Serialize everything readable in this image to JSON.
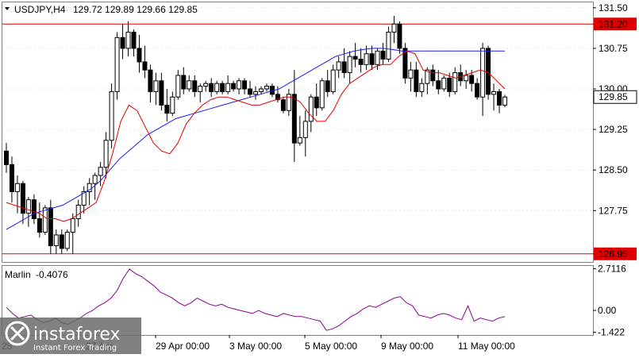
{
  "header": {
    "symbol": "USDJPY,H4",
    "ohlc": "129.72 129.89 129.66 129.85"
  },
  "indicator": {
    "name": "Marlin",
    "value": "-0.4076",
    "ticks": [
      "2.7116",
      "0.00",
      "-1.422"
    ]
  },
  "price_axis": {
    "ticks": [
      "131.50",
      "131.20",
      "130.75",
      "130.00",
      "129.85",
      "129.25",
      "128.50",
      "127.75",
      "126.95"
    ],
    "highlighted": [
      "131.20",
      "126.95"
    ],
    "current": "129.85"
  },
  "time_axis": {
    "labels": [
      "29 Apr 00:00",
      "3 May 00:00",
      "5 May 00:00",
      "9 May 00:00",
      "11 May 00:00"
    ],
    "partial_labels": [
      "25",
      "27 Apr"
    ]
  },
  "logo": {
    "brand": "instaforex",
    "tagline": "Instant Forex Trading"
  },
  "colors": {
    "resistance_line": "#e00000",
    "ma_fast": "#e00000",
    "ma_slow": "#1a1aff",
    "oscillator": "#8b008b",
    "bull_candle": "#ffffff",
    "bear_candle": "#000000"
  },
  "chart_data": [
    {
      "type": "candlestick",
      "title": "USDJPY,H4",
      "ylim": [
        126.8,
        131.6
      ],
      "horizontal_lines": [
        131.2,
        126.95
      ],
      "current_price": 129.85,
      "candles": [
        [
          128.85,
          129.0,
          128.45,
          128.6
        ],
        [
          128.6,
          128.75,
          127.9,
          128.1
        ],
        [
          128.1,
          128.4,
          127.7,
          128.25
        ],
        [
          128.25,
          128.3,
          127.5,
          127.7
        ],
        [
          127.7,
          128.0,
          127.45,
          127.95
        ],
        [
          127.95,
          128.05,
          127.5,
          127.6
        ],
        [
          127.6,
          127.9,
          127.25,
          127.35
        ],
        [
          127.35,
          127.85,
          127.3,
          127.8
        ],
        [
          127.8,
          127.95,
          126.95,
          127.1
        ],
        [
          127.1,
          127.4,
          126.95,
          127.3
        ],
        [
          127.3,
          127.4,
          126.95,
          127.05
        ],
        [
          127.05,
          127.4,
          127.0,
          127.35
        ],
        [
          127.35,
          127.7,
          126.95,
          127.6
        ],
        [
          127.6,
          127.95,
          127.45,
          127.85
        ],
        [
          127.85,
          128.2,
          127.7,
          128.1
        ],
        [
          128.1,
          128.35,
          127.85,
          128.25
        ],
        [
          128.25,
          128.45,
          127.95,
          128.4
        ],
        [
          128.4,
          128.65,
          128.2,
          128.55
        ],
        [
          128.55,
          129.2,
          128.35,
          129.05
        ],
        [
          129.05,
          130.1,
          128.9,
          129.95
        ],
        [
          129.95,
          131.05,
          129.8,
          130.95
        ],
        [
          130.95,
          131.2,
          130.55,
          130.75
        ],
        [
          130.75,
          131.25,
          130.6,
          131.05
        ],
        [
          131.05,
          131.1,
          130.6,
          130.75
        ],
        [
          130.75,
          131.0,
          130.3,
          130.5
        ],
        [
          130.5,
          130.8,
          130.2,
          130.35
        ],
        [
          130.35,
          130.45,
          129.75,
          129.95
        ],
        [
          129.95,
          130.3,
          129.7,
          130.15
        ],
        [
          130.15,
          130.3,
          129.6,
          129.7
        ],
        [
          129.7,
          130.0,
          129.4,
          129.55
        ],
        [
          129.55,
          129.95,
          129.5,
          129.85
        ],
        [
          129.85,
          130.35,
          129.8,
          130.25
        ],
        [
          130.25,
          130.4,
          129.9,
          130.0
        ],
        [
          130.0,
          130.25,
          129.95,
          130.15
        ],
        [
          130.15,
          130.25,
          129.85,
          129.95
        ],
        [
          129.95,
          130.1,
          129.75,
          130.05
        ],
        [
          130.05,
          130.15,
          129.95,
          130.1
        ],
        [
          130.1,
          130.2,
          129.85,
          129.95
        ],
        [
          129.95,
          130.15,
          129.9,
          130.1
        ],
        [
          130.1,
          130.15,
          129.9,
          129.95
        ],
        [
          129.95,
          130.25,
          129.9,
          130.1
        ],
        [
          130.1,
          130.15,
          129.95,
          130.0
        ],
        [
          130.0,
          130.2,
          129.9,
          130.15
        ],
        [
          130.15,
          130.2,
          129.9,
          130.0
        ],
        [
          130.0,
          130.15,
          129.85,
          129.9
        ],
        [
          129.9,
          130.05,
          129.8,
          129.95
        ],
        [
          129.95,
          130.05,
          129.9,
          130.0
        ],
        [
          130.0,
          130.1,
          129.95,
          130.05
        ],
        [
          130.05,
          130.1,
          129.85,
          129.9
        ],
        [
          129.9,
          130.05,
          129.75,
          129.8
        ],
        [
          129.8,
          129.85,
          129.55,
          129.6
        ],
        [
          129.6,
          130.0,
          129.5,
          129.9
        ],
        [
          129.9,
          130.35,
          128.65,
          129.0
        ],
        [
          129.0,
          129.5,
          128.95,
          129.1
        ],
        [
          129.1,
          129.6,
          128.75,
          129.4
        ],
        [
          129.4,
          129.9,
          129.2,
          129.85
        ],
        [
          129.85,
          130.1,
          129.5,
          129.65
        ],
        [
          129.65,
          130.2,
          129.6,
          130.15
        ],
        [
          130.15,
          130.35,
          129.85,
          129.95
        ],
        [
          129.95,
          130.45,
          129.9,
          130.35
        ],
        [
          130.35,
          130.6,
          130.2,
          130.5
        ],
        [
          130.5,
          130.75,
          130.2,
          130.3
        ],
        [
          130.3,
          130.7,
          130.1,
          130.6
        ],
        [
          130.6,
          130.85,
          130.4,
          130.55
        ],
        [
          130.55,
          130.75,
          130.3,
          130.45
        ],
        [
          130.45,
          130.8,
          130.35,
          130.65
        ],
        [
          130.65,
          130.8,
          130.35,
          130.45
        ],
        [
          130.45,
          130.75,
          130.35,
          130.7
        ],
        [
          130.7,
          130.85,
          130.45,
          130.55
        ],
        [
          130.55,
          131.15,
          130.5,
          131.05
        ],
        [
          131.05,
          131.35,
          130.85,
          131.2
        ],
        [
          131.2,
          131.25,
          130.65,
          130.75
        ],
        [
          130.75,
          130.85,
          130.1,
          130.2
        ],
        [
          130.2,
          130.5,
          129.95,
          130.35
        ],
        [
          130.35,
          130.5,
          129.85,
          129.95
        ],
        [
          129.95,
          130.2,
          129.85,
          130.1
        ],
        [
          130.1,
          130.4,
          129.9,
          130.35
        ],
        [
          130.35,
          130.45,
          130.05,
          130.15
        ],
        [
          130.15,
          130.35,
          129.9,
          130.0
        ],
        [
          130.0,
          130.25,
          129.95,
          130.2
        ],
        [
          130.2,
          130.3,
          129.85,
          129.95
        ],
        [
          129.95,
          130.4,
          129.9,
          130.3
        ],
        [
          130.3,
          130.45,
          130.05,
          130.15
        ],
        [
          130.15,
          130.35,
          130.0,
          130.25
        ],
        [
          130.25,
          130.35,
          129.95,
          130.1
        ],
        [
          130.1,
          130.2,
          129.8,
          129.85
        ],
        [
          129.85,
          130.85,
          129.5,
          130.75
        ],
        [
          130.75,
          130.8,
          129.8,
          129.9
        ],
        [
          129.9,
          130.1,
          129.6,
          129.95
        ],
        [
          129.95,
          130.0,
          129.55,
          129.7
        ],
        [
          129.7,
          129.89,
          129.66,
          129.85
        ]
      ],
      "ma_fast": [
        127.9,
        127.85,
        127.8,
        127.75,
        127.7,
        127.6,
        127.6,
        127.55,
        127.6,
        127.7,
        127.8,
        127.9,
        128.3,
        128.8,
        129.4,
        129.7,
        129.6,
        129.3,
        129.0,
        128.85,
        128.8,
        129.0,
        129.35,
        129.55,
        129.7,
        129.8,
        129.85,
        129.85,
        129.8,
        129.75,
        129.7,
        129.7,
        129.75,
        129.8,
        129.85,
        129.85,
        129.75,
        129.55,
        129.4,
        129.4,
        129.6,
        129.9,
        130.1,
        130.2,
        130.3,
        130.4,
        130.45,
        130.45,
        130.6,
        130.7,
        130.65,
        130.35,
        130.3,
        130.3,
        130.25,
        130.2,
        130.25,
        130.3,
        130.35,
        130.3,
        130.15,
        130.0
      ],
      "ma_slow": [
        127.4,
        127.5,
        127.6,
        127.7,
        127.75,
        127.8,
        127.85,
        127.95,
        128.05,
        128.15,
        128.3,
        128.5,
        128.7,
        128.85,
        129.0,
        129.15,
        129.25,
        129.35,
        129.45,
        129.5,
        129.55,
        129.6,
        129.65,
        129.7,
        129.75,
        129.8,
        129.85,
        129.9,
        129.95,
        130.0,
        130.1,
        130.2,
        130.3,
        130.4,
        130.5,
        130.6,
        130.65,
        130.7,
        130.73,
        130.75,
        130.75,
        130.73,
        130.7,
        130.7,
        130.7,
        130.7,
        130.7,
        130.7,
        130.7,
        130.7,
        130.7,
        130.7,
        130.7,
        130.7
      ]
    },
    {
      "type": "line",
      "title": "Marlin -0.4076",
      "ylim": [
        -1.6,
        2.9
      ],
      "ticks": [
        2.7116,
        0.0,
        -1.422
      ],
      "values": [
        0.2,
        -0.2,
        -0.5,
        -0.4,
        -0.3,
        -0.6,
        -0.8,
        -0.7,
        -0.5,
        -0.8,
        -0.9,
        -0.7,
        -0.5,
        -0.2,
        0.0,
        0.3,
        0.5,
        0.8,
        1.3,
        2.1,
        2.7,
        2.4,
        2.2,
        1.9,
        1.6,
        1.2,
        1.0,
        0.8,
        0.5,
        0.3,
        0.5,
        0.8,
        0.6,
        0.4,
        0.3,
        0.4,
        0.2,
        0.1,
        0.0,
        -0.1,
        -0.2,
        0.0,
        -0.2,
        -0.3,
        -0.4,
        -0.2,
        -0.3,
        -0.4,
        -0.4,
        -0.5,
        -0.6,
        -0.7,
        -1.3,
        -1.2,
        -1.0,
        -0.7,
        -0.4,
        -0.2,
        0.1,
        0.3,
        0.2,
        0.4,
        0.6,
        0.8,
        0.9,
        0.5,
        0.3,
        -0.3,
        -0.4,
        -0.5,
        -0.3,
        -0.2,
        -0.3,
        -0.5,
        -0.6,
        0.3,
        -0.7,
        -0.5,
        -0.6,
        -0.7,
        -0.5,
        -0.4076
      ]
    }
  ]
}
